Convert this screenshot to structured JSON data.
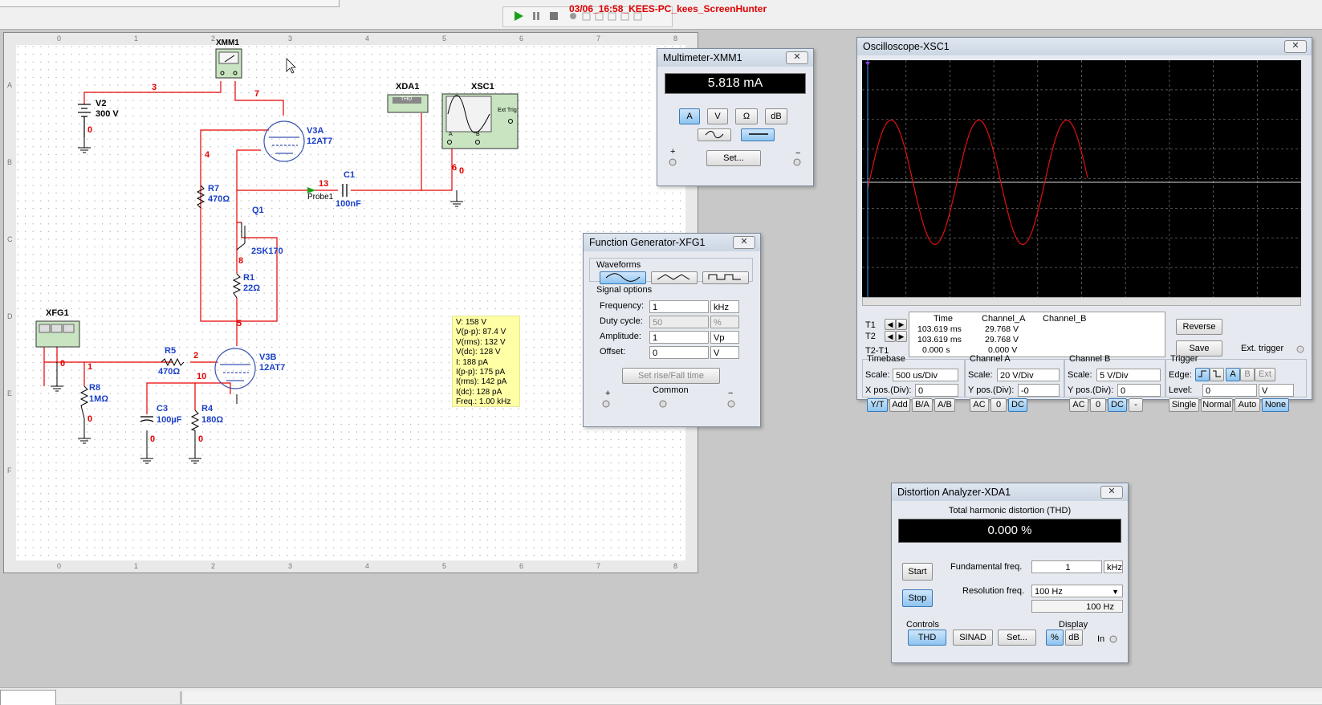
{
  "screenhunter": "03/06_16:58_KEES-PC_kees_ScreenHunter",
  "circuit": {
    "components": {
      "xmm1": "XMM1",
      "v2": "V2",
      "v2_value": "300 V",
      "v3a": "V3A",
      "v3a_type": "12AT7",
      "xda1": "XDA1",
      "xda1_badge": "THD",
      "xsc1": "XSC1",
      "ext_trig": "Ext Trig",
      "r7": "R7",
      "r7_value": "470Ω",
      "probe": "Probe1",
      "c1": "C1",
      "c1_value": "100nF",
      "q1": "Q1",
      "q1_type": "2SK170",
      "r1": "R1",
      "r1_value": "22Ω",
      "xfg1": "XFG1",
      "r5": "R5",
      "r5_value": "470Ω",
      "v3b": "V3B",
      "v3b_type": "12AT7",
      "r8": "R8",
      "r8_value": "1MΩ",
      "c3": "C3",
      "c3_value": "100µF",
      "r4": "R4",
      "r4_value": "180Ω",
      "sc_a": "A",
      "sc_b": "B"
    },
    "nets": {
      "n3": "3",
      "n7": "7",
      "n0a": "0",
      "n4": "4",
      "n13": "13",
      "n6": "6",
      "n0b": "0",
      "n8": "8",
      "n5": "5",
      "n0c": "0",
      "n1": "1",
      "n2": "2",
      "n10": "10",
      "n0d": "0",
      "n0e": "0",
      "n0f": "0"
    },
    "probe_readout": [
      "V: 158 V",
      "V(p-p): 87.4 V",
      "V(rms): 132 V",
      "V(dc): 128 V",
      "I: 188 pA",
      "I(p-p): 175 pA",
      "I(rms): 142 pA",
      "I(dc): 128 pA",
      "Freq.: 1.00 kHz"
    ],
    "ruler_cols": [
      "0",
      "1",
      "2",
      "3",
      "4",
      "5",
      "6",
      "7",
      "8"
    ],
    "ruler_rows": [
      "A",
      "B",
      "C",
      "D",
      "E",
      "F"
    ]
  },
  "multimeter": {
    "title": "Multimeter-XMM1",
    "reading": "5.818 mA",
    "modes": [
      "A",
      "V",
      "Ω",
      "dB"
    ],
    "active_mode": "A",
    "set_label": "Set...",
    "plus": "+",
    "minus": "−"
  },
  "funcgen": {
    "title": "Function Generator-XFG1",
    "waveforms_label": "Waveforms",
    "signal_options_label": "Signal options",
    "rows": [
      {
        "label": "Frequency:",
        "value": "1",
        "unit": "kHz",
        "disabled": false
      },
      {
        "label": "Duty cycle:",
        "value": "50",
        "unit": "%",
        "disabled": true
      },
      {
        "label": "Amplitude:",
        "value": "1",
        "unit": "Vp",
        "disabled": false
      },
      {
        "label": "Offset:",
        "value": "0",
        "unit": "V",
        "disabled": false
      }
    ],
    "rise_fall_label": "Set rise/Fall time",
    "plus": "+",
    "common": "Common",
    "minus": "−"
  },
  "oscilloscope": {
    "title": "Oscilloscope-XSC1",
    "trace_color": "#e01010",
    "readout": {
      "headers": [
        "Time",
        "Channel_A",
        "Channel_B"
      ],
      "t1_label": "T1",
      "t2_label": "T2",
      "t2t1_label": "T2-T1",
      "t1": [
        "103.619 ms",
        "29.768 V",
        ""
      ],
      "t2": [
        "103.619 ms",
        "29.768 V",
        ""
      ],
      "t2t1": [
        "0.000 s",
        "0.000 V",
        ""
      ]
    },
    "reverse_label": "Reverse",
    "save_label": "Save",
    "ext_trigger_label": "Ext. trigger",
    "timebase": {
      "label": "Timebase",
      "scale_label": "Scale:",
      "scale": "500 us/Div",
      "pos_label": "X pos.(Div):",
      "pos": "0",
      "buttons": [
        "Y/T",
        "Add",
        "B/A",
        "A/B"
      ]
    },
    "channel_a": {
      "label": "Channel A",
      "scale_label": "Scale:",
      "scale": "20  V/Div",
      "pos_label": "Y pos.(Div):",
      "pos": "-0",
      "buttons": [
        "AC",
        "0",
        "DC"
      ]
    },
    "channel_b": {
      "label": "Channel B",
      "scale_label": "Scale:",
      "scale": "5  V/Div",
      "pos_label": "Y pos.(Div):",
      "pos": "0",
      "buttons": [
        "AC",
        "0",
        "DC",
        "-"
      ]
    },
    "trigger": {
      "label": "Trigger",
      "edge_label": "Edge:",
      "edge_buttons": [
        "A",
        "B",
        "Ext"
      ],
      "level_label": "Level:",
      "level": "0",
      "level_unit": "V",
      "modes": [
        "Single",
        "Normal",
        "Auto",
        "None"
      ]
    }
  },
  "distortion": {
    "title": "Distortion Analyzer-XDA1",
    "thd_label": "Total harmonic distortion (THD)",
    "reading": "0.000 %",
    "start_label": "Start",
    "stop_label": "Stop",
    "fund_label": "Fundamental freq.",
    "fund_value": "1",
    "fund_unit": "kHz",
    "res_label": "Resolution freq.",
    "res_value": "100 Hz",
    "res_display": "100 Hz",
    "controls_label": "Controls",
    "display_label": "Display",
    "control_buttons": [
      "THD",
      "SINAD",
      "Set..."
    ],
    "display_buttons": [
      "%",
      "dB"
    ],
    "in_label": "In"
  }
}
